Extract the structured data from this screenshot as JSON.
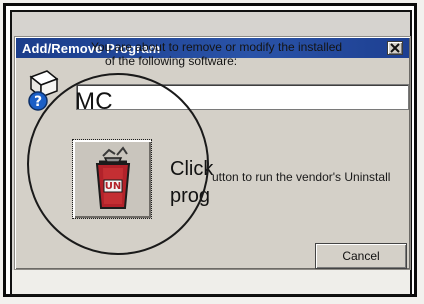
{
  "dialog": {
    "title": "Add/Remove Program",
    "message_line1": "You are about to remove or modify the installed",
    "message_line2": "of the following software:",
    "program_name_partial": "MC",
    "run_instruction_part1": "Click",
    "run_instruction_part2": "utton to run the vendor's Uninstall",
    "run_instruction_partial_next": "prog",
    "cancel_label": "Cancel",
    "uninstall_icon_label": "UN"
  },
  "icons": {
    "close": "close-icon",
    "program": "program-icon",
    "uninstall": "uninstall-icon"
  },
  "colors": {
    "titlebar_start": "#1b3d8b",
    "titlebar_end": "#2a53a8",
    "dialog_gray": "#d4d0c8",
    "frame_black": "#0b0b0b",
    "uninstall_red": "#b2222a"
  }
}
